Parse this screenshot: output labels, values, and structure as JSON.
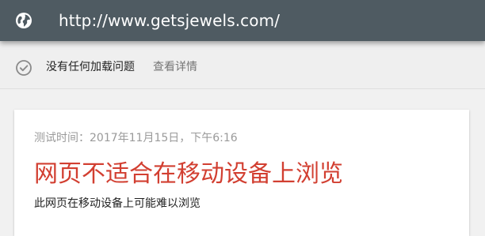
{
  "header": {
    "url": "http://www.getsjewels.com/",
    "icon": "globe-icon"
  },
  "status": {
    "icon": "check-circle-icon",
    "message": "没有任何加载问题",
    "details_link": "查看详情"
  },
  "result_card": {
    "test_time": "测试时间：2017年11月15日，下午6:16",
    "title": "网页不适合在移动设备上浏览",
    "description": "此网页在移动设备上可能难以浏览"
  },
  "colors": {
    "header_bg": "#4f5b62",
    "title_red": "#d23f31"
  }
}
